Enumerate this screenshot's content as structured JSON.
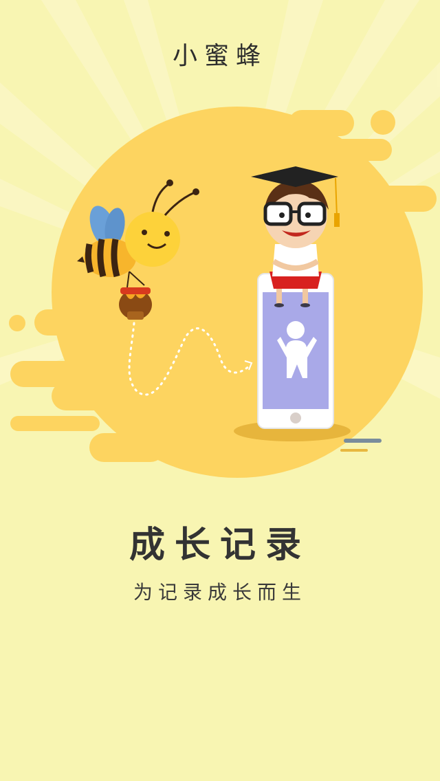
{
  "app": {
    "title": "小蜜蜂"
  },
  "slide": {
    "headline": "成长记录",
    "subtitle": "为记录成长而生"
  },
  "colors": {
    "background": "#f8f5b2",
    "blob": "#fdd460",
    "bee_yellow": "#fdd23a",
    "phone_screen": "#a9a9e8",
    "text": "#333333"
  },
  "icons": {
    "bee": "bee-illustration",
    "student": "student-with-graduation-cap",
    "phone": "smartphone-with-child-icon"
  }
}
